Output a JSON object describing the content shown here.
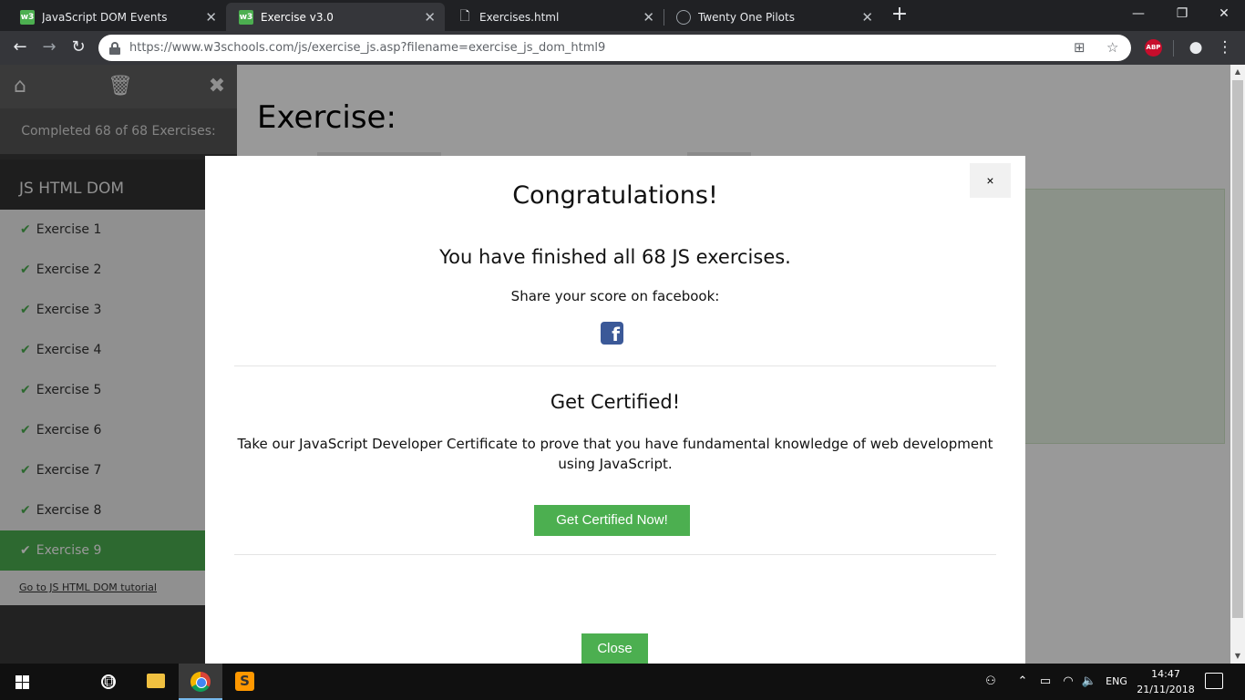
{
  "browser": {
    "tabs": [
      {
        "title": "JavaScript DOM Events",
        "favicon": "w3"
      },
      {
        "title": "Exercise v3.0",
        "favicon": "w3"
      },
      {
        "title": "Exercises.html",
        "favicon": "doc"
      },
      {
        "title": "Twenty One Pilots",
        "favicon": "circle"
      }
    ],
    "active_tab": 1,
    "url": "https://www.w3schools.com/js/exercise_js.asp?filename=exercise_js_dom_html9",
    "ext_abp": "ABP"
  },
  "sidebar": {
    "progress": "Completed 68 of 68 Exercises:",
    "heading": "JS HTML DOM",
    "items": [
      {
        "label": "Exercise 1"
      },
      {
        "label": "Exercise 2"
      },
      {
        "label": "Exercise 3"
      },
      {
        "label": "Exercise 4"
      },
      {
        "label": "Exercise 5"
      },
      {
        "label": "Exercise 6"
      },
      {
        "label": "Exercise 7"
      },
      {
        "label": "Exercise 8"
      },
      {
        "label": "Exercise 9"
      }
    ],
    "active_item": 8,
    "tutorial_link": "Go to JS HTML DOM tutorial"
  },
  "main": {
    "title": "Exercise:"
  },
  "modal": {
    "close_x": "×",
    "title": "Congratulations!",
    "finished": "You have finished all 68 JS exercises.",
    "share": "Share your score on facebook:",
    "facebook_glyph": "f",
    "cert_title": "Get Certified!",
    "cert_text": "Take our JavaScript Developer Certificate to prove that you have fundamental knowledge of web development using JavaScript.",
    "cert_button": "Get Certified Now!",
    "close_button": "Close"
  },
  "taskbar": {
    "language": "ENG",
    "time": "14:47",
    "date": "21/11/2018"
  },
  "colors": {
    "accent_green": "#4caf50",
    "facebook_blue": "#3b5998",
    "sidebar_dark": "#3a3a3a"
  }
}
